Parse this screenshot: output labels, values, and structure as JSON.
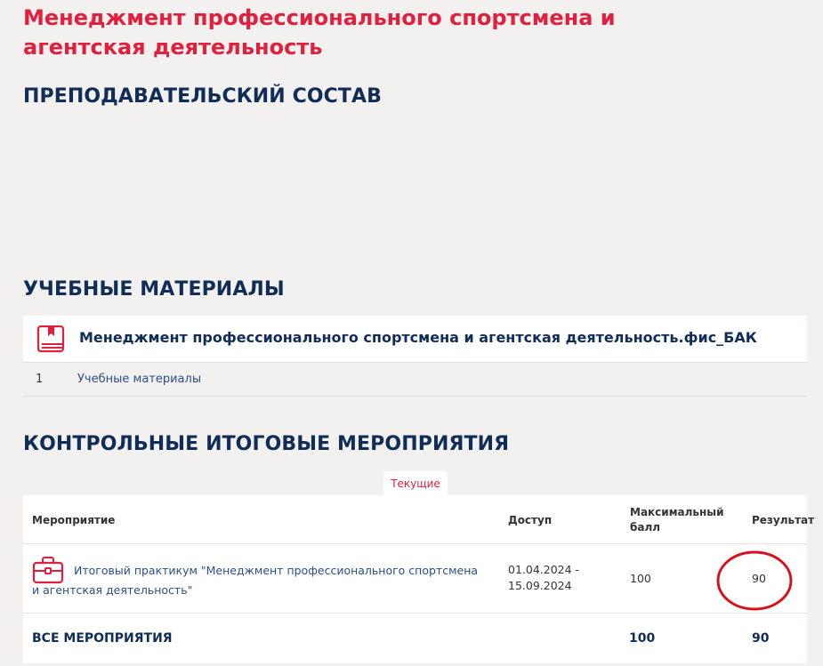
{
  "course": {
    "title": "Менеджмент профессионального спортсмена и агентская деятельность"
  },
  "sections": {
    "staff_heading": "ПРЕПОДАВАТЕЛЬСКИЙ СОСТАВ",
    "materials_heading": "УЧЕБНЫЕ МАТЕРИАЛЫ",
    "events_heading": "КОНТРОЛЬНЫЕ ИТОГОВЫЕ МЕРОПРИЯТИЯ"
  },
  "materials": {
    "card_title": "Менеджмент профессионального спортсмена и агентская деятельность.фис_БАК",
    "icon": "book-icon",
    "items": [
      {
        "number": "1",
        "label": "Учебные материалы"
      }
    ]
  },
  "events": {
    "tab_label": "Текущие",
    "columns": {
      "event": "Мероприятие",
      "access": "Доступ",
      "max_score": "Максимальный балл",
      "result": "Результат"
    },
    "rows": [
      {
        "icon": "briefcase-icon",
        "name": "Итоговый практикум \"Менеджмент профессионального спортсмена и агентская деятельность\"",
        "access": "01.04.2024 - 15.09.2024",
        "max_score": "100",
        "result": "90"
      }
    ],
    "total": {
      "label": "ВСЕ МЕРОПРИЯТИЯ",
      "max_score": "100",
      "result": "90"
    }
  },
  "colors": {
    "accent_red": "#e0203e",
    "heading_navy": "#102d57",
    "link_blue": "#2a4f86",
    "background": "#f2f1ef",
    "highlight_circle": "#d8101c"
  }
}
